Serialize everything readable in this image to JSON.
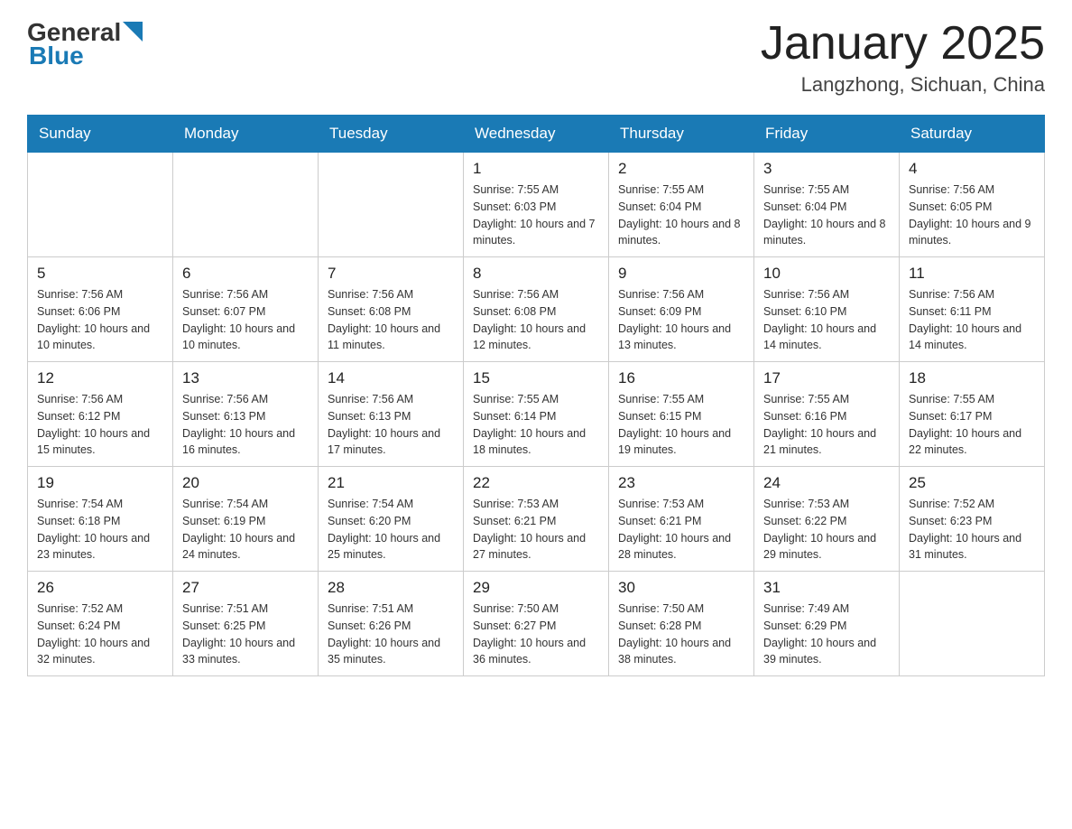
{
  "header": {
    "logo": {
      "general": "General",
      "blue": "Blue"
    },
    "title": "January 2025",
    "location": "Langzhong, Sichuan, China"
  },
  "calendar": {
    "days_of_week": [
      "Sunday",
      "Monday",
      "Tuesday",
      "Wednesday",
      "Thursday",
      "Friday",
      "Saturday"
    ],
    "weeks": [
      [
        {
          "day": "",
          "info": ""
        },
        {
          "day": "",
          "info": ""
        },
        {
          "day": "",
          "info": ""
        },
        {
          "day": "1",
          "info": "Sunrise: 7:55 AM\nSunset: 6:03 PM\nDaylight: 10 hours and 7 minutes."
        },
        {
          "day": "2",
          "info": "Sunrise: 7:55 AM\nSunset: 6:04 PM\nDaylight: 10 hours and 8 minutes."
        },
        {
          "day": "3",
          "info": "Sunrise: 7:55 AM\nSunset: 6:04 PM\nDaylight: 10 hours and 8 minutes."
        },
        {
          "day": "4",
          "info": "Sunrise: 7:56 AM\nSunset: 6:05 PM\nDaylight: 10 hours and 9 minutes."
        }
      ],
      [
        {
          "day": "5",
          "info": "Sunrise: 7:56 AM\nSunset: 6:06 PM\nDaylight: 10 hours and 10 minutes."
        },
        {
          "day": "6",
          "info": "Sunrise: 7:56 AM\nSunset: 6:07 PM\nDaylight: 10 hours and 10 minutes."
        },
        {
          "day": "7",
          "info": "Sunrise: 7:56 AM\nSunset: 6:08 PM\nDaylight: 10 hours and 11 minutes."
        },
        {
          "day": "8",
          "info": "Sunrise: 7:56 AM\nSunset: 6:08 PM\nDaylight: 10 hours and 12 minutes."
        },
        {
          "day": "9",
          "info": "Sunrise: 7:56 AM\nSunset: 6:09 PM\nDaylight: 10 hours and 13 minutes."
        },
        {
          "day": "10",
          "info": "Sunrise: 7:56 AM\nSunset: 6:10 PM\nDaylight: 10 hours and 14 minutes."
        },
        {
          "day": "11",
          "info": "Sunrise: 7:56 AM\nSunset: 6:11 PM\nDaylight: 10 hours and 14 minutes."
        }
      ],
      [
        {
          "day": "12",
          "info": "Sunrise: 7:56 AM\nSunset: 6:12 PM\nDaylight: 10 hours and 15 minutes."
        },
        {
          "day": "13",
          "info": "Sunrise: 7:56 AM\nSunset: 6:13 PM\nDaylight: 10 hours and 16 minutes."
        },
        {
          "day": "14",
          "info": "Sunrise: 7:56 AM\nSunset: 6:13 PM\nDaylight: 10 hours and 17 minutes."
        },
        {
          "day": "15",
          "info": "Sunrise: 7:55 AM\nSunset: 6:14 PM\nDaylight: 10 hours and 18 minutes."
        },
        {
          "day": "16",
          "info": "Sunrise: 7:55 AM\nSunset: 6:15 PM\nDaylight: 10 hours and 19 minutes."
        },
        {
          "day": "17",
          "info": "Sunrise: 7:55 AM\nSunset: 6:16 PM\nDaylight: 10 hours and 21 minutes."
        },
        {
          "day": "18",
          "info": "Sunrise: 7:55 AM\nSunset: 6:17 PM\nDaylight: 10 hours and 22 minutes."
        }
      ],
      [
        {
          "day": "19",
          "info": "Sunrise: 7:54 AM\nSunset: 6:18 PM\nDaylight: 10 hours and 23 minutes."
        },
        {
          "day": "20",
          "info": "Sunrise: 7:54 AM\nSunset: 6:19 PM\nDaylight: 10 hours and 24 minutes."
        },
        {
          "day": "21",
          "info": "Sunrise: 7:54 AM\nSunset: 6:20 PM\nDaylight: 10 hours and 25 minutes."
        },
        {
          "day": "22",
          "info": "Sunrise: 7:53 AM\nSunset: 6:21 PM\nDaylight: 10 hours and 27 minutes."
        },
        {
          "day": "23",
          "info": "Sunrise: 7:53 AM\nSunset: 6:21 PM\nDaylight: 10 hours and 28 minutes."
        },
        {
          "day": "24",
          "info": "Sunrise: 7:53 AM\nSunset: 6:22 PM\nDaylight: 10 hours and 29 minutes."
        },
        {
          "day": "25",
          "info": "Sunrise: 7:52 AM\nSunset: 6:23 PM\nDaylight: 10 hours and 31 minutes."
        }
      ],
      [
        {
          "day": "26",
          "info": "Sunrise: 7:52 AM\nSunset: 6:24 PM\nDaylight: 10 hours and 32 minutes."
        },
        {
          "day": "27",
          "info": "Sunrise: 7:51 AM\nSunset: 6:25 PM\nDaylight: 10 hours and 33 minutes."
        },
        {
          "day": "28",
          "info": "Sunrise: 7:51 AM\nSunset: 6:26 PM\nDaylight: 10 hours and 35 minutes."
        },
        {
          "day": "29",
          "info": "Sunrise: 7:50 AM\nSunset: 6:27 PM\nDaylight: 10 hours and 36 minutes."
        },
        {
          "day": "30",
          "info": "Sunrise: 7:50 AM\nSunset: 6:28 PM\nDaylight: 10 hours and 38 minutes."
        },
        {
          "day": "31",
          "info": "Sunrise: 7:49 AM\nSunset: 6:29 PM\nDaylight: 10 hours and 39 minutes."
        },
        {
          "day": "",
          "info": ""
        }
      ]
    ]
  }
}
